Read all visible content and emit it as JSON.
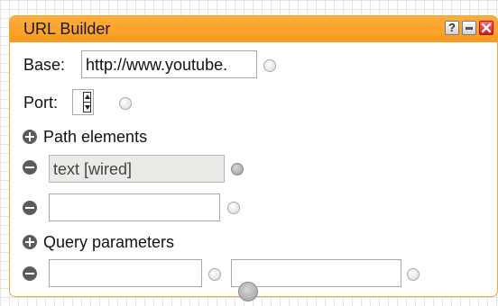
{
  "window": {
    "title": "URL Builder",
    "buttons": {
      "help": "?",
      "minimize": "minimize",
      "close": "close"
    },
    "accent_color": "#f79a1e"
  },
  "base": {
    "label": "Base:",
    "value": "http://www.youtube."
  },
  "port": {
    "label": "Port:",
    "value": ""
  },
  "path": {
    "header": "Path elements",
    "items": [
      {
        "value": "text [wired]",
        "wired": true
      },
      {
        "value": "",
        "wired": false
      }
    ]
  },
  "query": {
    "header": "Query parameters",
    "items": [
      {
        "key": "",
        "value": ""
      }
    ]
  }
}
